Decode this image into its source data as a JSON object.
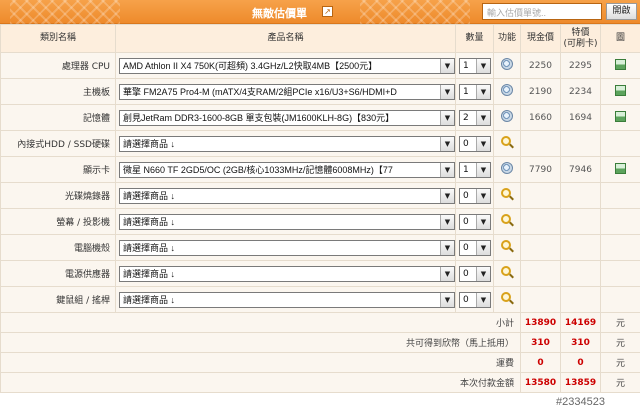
{
  "title": "無敵估價單",
  "search_placeholder": "輸入估價單號..",
  "open_button": "開啟",
  "headers": {
    "category": "類別名稱",
    "product": "產品名稱",
    "qty": "數量",
    "func": "功能",
    "cash": "現金價",
    "special": "特價\n(可刷卡)",
    "pic": "圖"
  },
  "rows": [
    {
      "category": "處理器 CPU",
      "product": "AMD Athlon II X4 750K(可超頻) 3.4GHz/L2快取4MB【2500元】",
      "qty": "1",
      "func_icon": "gear-icon",
      "cash": "2250",
      "special": "2295",
      "has_pic": true
    },
    {
      "category": "主機板",
      "product": "華擎 FM2A75 Pro4-M (mATX/4支RAM/2組PCIe x16/U3+S6/HDMI+D",
      "qty": "1",
      "func_icon": "gear-icon",
      "cash": "2190",
      "special": "2234",
      "has_pic": true
    },
    {
      "category": "記憶體",
      "product": "創見JetRam DDR3-1600-8GB 單支包裝(JM1600KLH-8G)【830元】",
      "qty": "2",
      "func_icon": "gear-icon",
      "cash": "1660",
      "special": "1694",
      "has_pic": true
    },
    {
      "category": "內接式HDD / SSD硬碟",
      "product": "請選擇商品 ↓",
      "qty": "0",
      "func_icon": "magnifier-icon",
      "cash": "",
      "special": "",
      "has_pic": false
    },
    {
      "category": "顯示卡",
      "product": "微星 N660 TF 2GD5/OC (2GB/核心1033MHz/記憶體6008MHz)【77",
      "qty": "1",
      "func_icon": "gear-icon",
      "cash": "7790",
      "special": "7946",
      "has_pic": true
    },
    {
      "category": "光碟燒錄器",
      "product": "請選擇商品 ↓",
      "qty": "0",
      "func_icon": "magnifier-icon",
      "cash": "",
      "special": "",
      "has_pic": false
    },
    {
      "category": "螢幕 / 投影機",
      "product": "請選擇商品 ↓",
      "qty": "0",
      "func_icon": "magnifier-icon",
      "cash": "",
      "special": "",
      "has_pic": false
    },
    {
      "category": "電腦機殼",
      "product": "請選擇商品 ↓",
      "qty": "0",
      "func_icon": "magnifier-icon",
      "cash": "",
      "special": "",
      "has_pic": false
    },
    {
      "category": "電源供應器",
      "product": "請選擇商品 ↓",
      "qty": "0",
      "func_icon": "magnifier-icon",
      "cash": "",
      "special": "",
      "has_pic": false
    },
    {
      "category": "鍵鼠組 / 搖桿",
      "product": "請選擇商品 ↓",
      "qty": "0",
      "func_icon": "magnifier-icon",
      "cash": "",
      "special": "",
      "has_pic": false
    }
  ],
  "summary": [
    {
      "label": "小計",
      "cash": "13890",
      "special": "14169",
      "unit": "元"
    },
    {
      "label": "共可得到欣幣（馬上抵用）",
      "cash": "310",
      "special": "310",
      "unit": "元"
    },
    {
      "label": "運費",
      "cash": "0",
      "special": "0",
      "unit": "元"
    },
    {
      "label": "本次付款金額",
      "cash": "13580",
      "special": "13859",
      "unit": "元"
    }
  ],
  "watermark": "#2334523",
  "colors": {
    "accent": "#ee8a2b",
    "total_red": "#cc0000",
    "row_bg": "#fbf6ef",
    "header_bg": "#fdeedd"
  }
}
